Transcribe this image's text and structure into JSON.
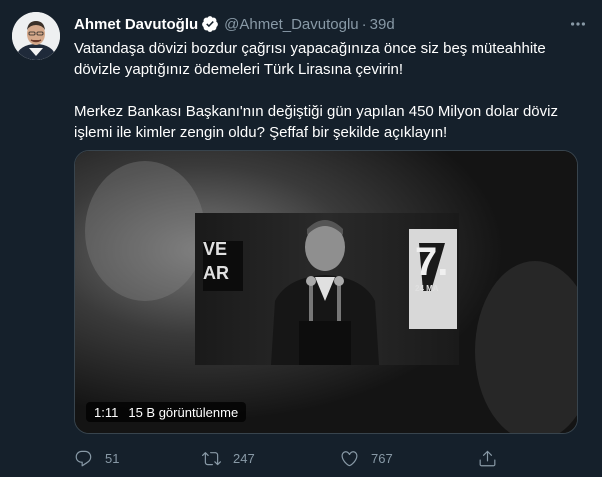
{
  "author": {
    "name": "Ahmet Davutoğlu",
    "handle": "@Ahmet_Davutoglu",
    "separator": "·",
    "time": "39d"
  },
  "tweet": {
    "paragraph1": "Vatandaşa dövizi bozdur çağrısı yapacağınıza önce siz beş müteahhite dövizle yaptığınız ödemeleri Türk Lirasına çevirin!",
    "paragraph2": "Merkez Bankası Başkanı'nın değiştiği gün yapılan 450 Milyon dolar döviz işlemi ile kimler zengin oldu? Şeffaf bir şekilde açıklayın!"
  },
  "media": {
    "duration": "1:11",
    "views": "15 B görüntülenme",
    "overlay_left": "VE\nAR",
    "overlay_right": "7.",
    "overlay_small": "24 MA"
  },
  "actions": {
    "reply_count": "51",
    "retweet_count": "247",
    "like_count": "767"
  },
  "colors": {
    "background": "#15202b",
    "secondary_text": "#8899a6",
    "verified_blue": "#1da1f2",
    "border": "#38444d"
  }
}
